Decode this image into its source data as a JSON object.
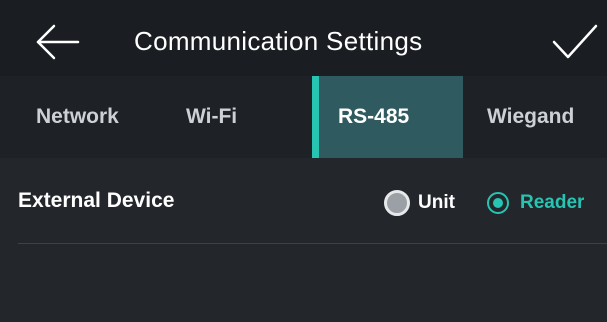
{
  "header": {
    "title": "Communication Settings",
    "back_icon": "arrow-left-icon",
    "confirm_icon": "checkmark-icon"
  },
  "tabs": [
    {
      "label": "Network",
      "active": false
    },
    {
      "label": "Wi-Fi",
      "active": false
    },
    {
      "label": "RS-485",
      "active": true
    },
    {
      "label": "Wiegand",
      "active": false
    }
  ],
  "settings": {
    "external_device": {
      "label": "External Device",
      "options": [
        {
          "label": "Unit",
          "selected": false
        },
        {
          "label": "Reader",
          "selected": true
        }
      ]
    }
  },
  "colors": {
    "accent": "#27c4b2",
    "background": "#23262b",
    "header": "#1a1d21",
    "active_tab": "#2f5a60"
  }
}
